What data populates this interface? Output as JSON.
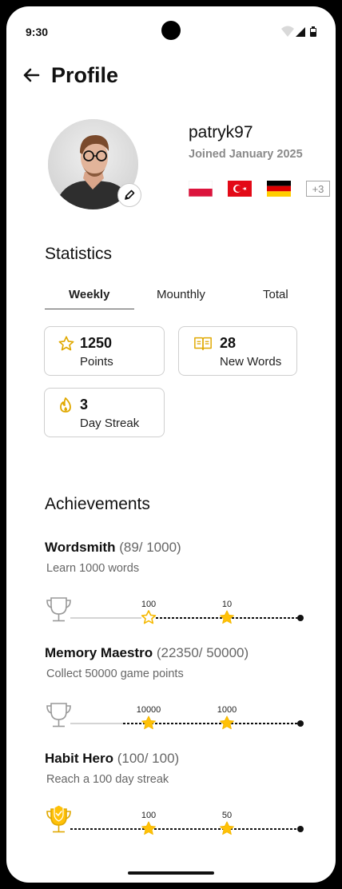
{
  "status_bar": {
    "time": "9:30"
  },
  "header": {
    "title": "Profile"
  },
  "profile": {
    "username": "patryk97",
    "joined": "Joined January 2025",
    "flags": [
      "poland-flag",
      "turkey-flag",
      "germany-flag"
    ],
    "more_flags": "+3"
  },
  "statistics": {
    "title": "Statistics",
    "tabs": [
      {
        "label": "Weekly",
        "active": true
      },
      {
        "label": "Mounthly",
        "active": false
      },
      {
        "label": "Total",
        "active": false
      }
    ],
    "cards": [
      {
        "icon": "star-icon",
        "value": "1250",
        "label": "Points"
      },
      {
        "icon": "book-icon",
        "value": "28",
        "label": "New Words"
      },
      {
        "icon": "flame-icon",
        "value": "3",
        "label": "Day Streak"
      }
    ]
  },
  "achievements": {
    "title": "Achievements",
    "items": [
      {
        "name": "Wordsmith",
        "progress": "(89/ 1000)",
        "description": "Learn 1000 words",
        "milestones": [
          "100",
          "10"
        ],
        "completed": false
      },
      {
        "name": "Memory Maestro",
        "progress": "(22350/ 50000)",
        "description": "Collect 50000 game points",
        "milestones": [
          "10000",
          "1000"
        ],
        "completed": false
      },
      {
        "name": "Habit Hero",
        "progress": "(100/ 100)",
        "description": "Reach a 100 day streak",
        "milestones": [
          "100",
          "50"
        ],
        "completed": true
      }
    ]
  },
  "colors": {
    "accent": "#FFC107",
    "accent_dark": "#E0A800",
    "muted": "#9A9A9A"
  }
}
